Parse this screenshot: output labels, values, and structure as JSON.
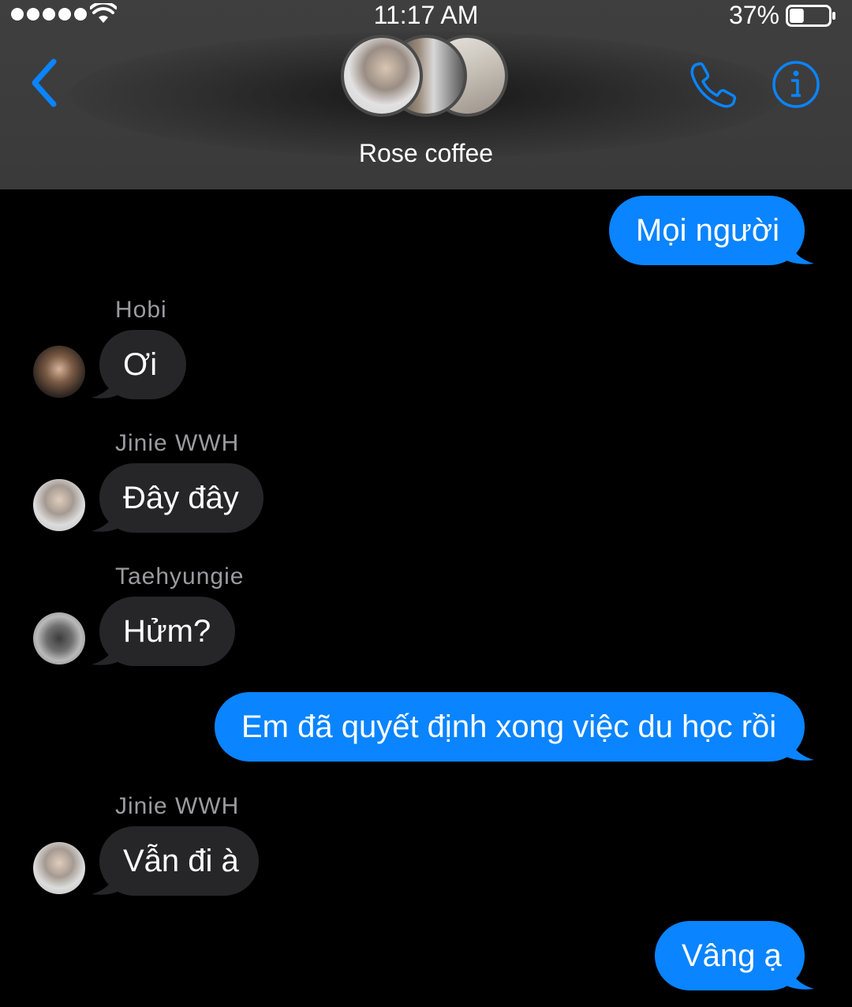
{
  "status_bar": {
    "time": "11:17 AM",
    "battery_percent": "37%",
    "battery_level": 0.37,
    "signal_icon": "cellular-dots-icon",
    "wifi_icon": "wifi-icon"
  },
  "header": {
    "title": "Rose coffee",
    "back_icon": "chevron-left-icon",
    "call_icon": "phone-icon",
    "info_icon": "info-icon",
    "accent_color": "#0a84ff"
  },
  "messages": [
    {
      "direction": "outgoing",
      "text": "Mọi người"
    },
    {
      "direction": "incoming",
      "sender": "Hobi",
      "text": "Ơi"
    },
    {
      "direction": "incoming",
      "sender": "Jinie WWH",
      "text": "Đây đây"
    },
    {
      "direction": "incoming",
      "sender": "Taehyungie",
      "text": "Hửm?"
    },
    {
      "direction": "outgoing",
      "text": "Em đã quyết định xong việc du học rồi"
    },
    {
      "direction": "incoming",
      "sender": "Jinie WWH",
      "text": "Vẫn đi à"
    },
    {
      "direction": "outgoing",
      "text": "Vâng ạ"
    }
  ],
  "colors": {
    "outgoing_bubble": "#0a84ff",
    "incoming_bubble": "#262629",
    "background": "#000000"
  }
}
